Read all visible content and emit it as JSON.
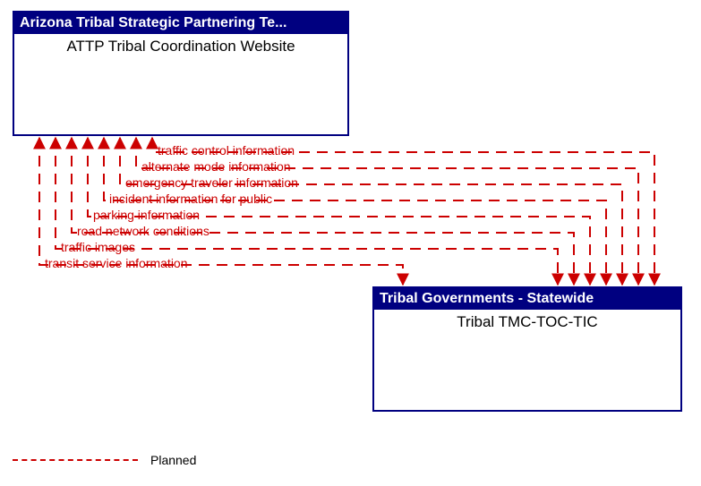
{
  "box_top": {
    "header": "Arizona Tribal Strategic Partnering Te...",
    "title": "ATTP Tribal Coordination Website"
  },
  "box_bottom": {
    "header": "Tribal Governments - Statewide",
    "title": "Tribal TMC-TOC-TIC"
  },
  "flows": [
    "traffic control information",
    "alternate mode information",
    "emergency traveler information",
    "incident information for public",
    "parking information",
    "road network conditions",
    "traffic images",
    "transit service information"
  ],
  "legend": {
    "label": "Planned",
    "style": "dashed",
    "color": "#cc0000"
  },
  "chart_data": {
    "type": "diagram",
    "title": "Interconnect diagram: ATTP Tribal Coordination Website ↔ Tribal TMC-TOC-TIC",
    "nodes": [
      {
        "id": "attp",
        "label": "ATTP Tribal Coordination Website",
        "owner": "Arizona Tribal Strategic Partnering Team"
      },
      {
        "id": "tmc",
        "label": "Tribal TMC-TOC-TIC",
        "owner": "Tribal Governments - Statewide"
      }
    ],
    "edges": [
      {
        "from": "tmc",
        "to": "attp",
        "label": "traffic control information",
        "status": "Planned",
        "bidirectional": true
      },
      {
        "from": "tmc",
        "to": "attp",
        "label": "alternate mode information",
        "status": "Planned",
        "bidirectional": true
      },
      {
        "from": "tmc",
        "to": "attp",
        "label": "emergency traveler information",
        "status": "Planned",
        "bidirectional": true
      },
      {
        "from": "tmc",
        "to": "attp",
        "label": "incident information for public",
        "status": "Planned",
        "bidirectional": true
      },
      {
        "from": "tmc",
        "to": "attp",
        "label": "parking information",
        "status": "Planned",
        "bidirectional": true
      },
      {
        "from": "tmc",
        "to": "attp",
        "label": "road network conditions",
        "status": "Planned",
        "bidirectional": true
      },
      {
        "from": "tmc",
        "to": "attp",
        "label": "traffic images",
        "status": "Planned",
        "bidirectional": true
      },
      {
        "from": "tmc",
        "to": "attp",
        "label": "transit service information",
        "status": "Planned",
        "bidirectional": true
      }
    ],
    "legend": [
      {
        "style": "dashed",
        "color": "#cc0000",
        "meaning": "Planned"
      }
    ]
  }
}
